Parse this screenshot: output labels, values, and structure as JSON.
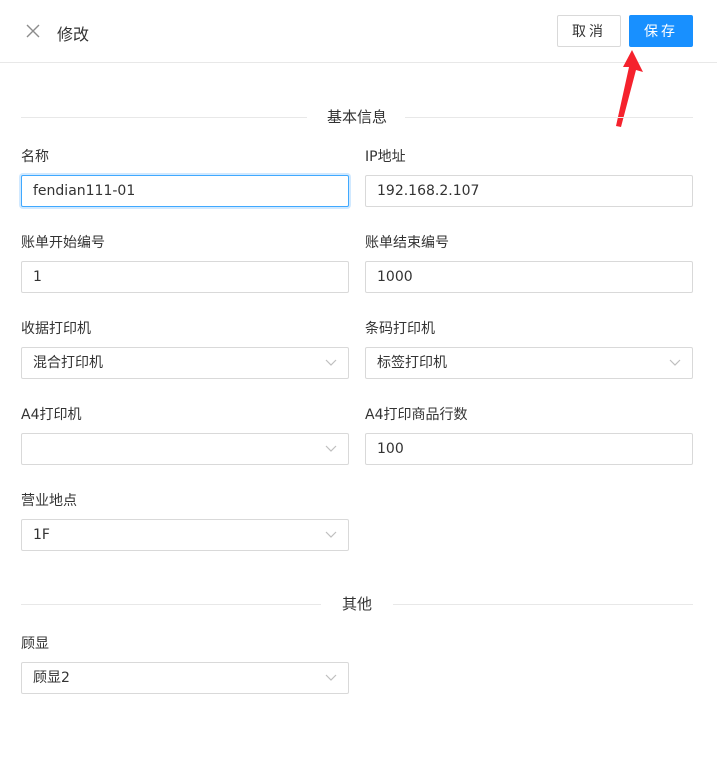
{
  "header": {
    "title": "修改",
    "cancel_label": "取消",
    "save_label": "保存"
  },
  "sections": {
    "basic": "基本信息",
    "other": "其他"
  },
  "fields": {
    "name": {
      "label": "名称",
      "value": "fendian111-01"
    },
    "ip": {
      "label": "IP地址",
      "value": "192.168.2.107"
    },
    "bill_start": {
      "label": "账单开始编号",
      "value": "1"
    },
    "bill_end": {
      "label": "账单结束编号",
      "value": "1000"
    },
    "receipt_printer": {
      "label": "收据打印机",
      "value": "混合打印机"
    },
    "barcode_printer": {
      "label": "条码打印机",
      "value": "标签打印机"
    },
    "a4_printer": {
      "label": "A4打印机",
      "value": ""
    },
    "a4_rows": {
      "label": "A4打印商品行数",
      "value": "100"
    },
    "location": {
      "label": "营业地点",
      "value": "1F"
    },
    "customer_display": {
      "label": "顾显",
      "value": "顾显2"
    }
  },
  "colors": {
    "primary": "#1890ff",
    "annotation_arrow": "#f5222d",
    "border": "#d9d9d9"
  }
}
